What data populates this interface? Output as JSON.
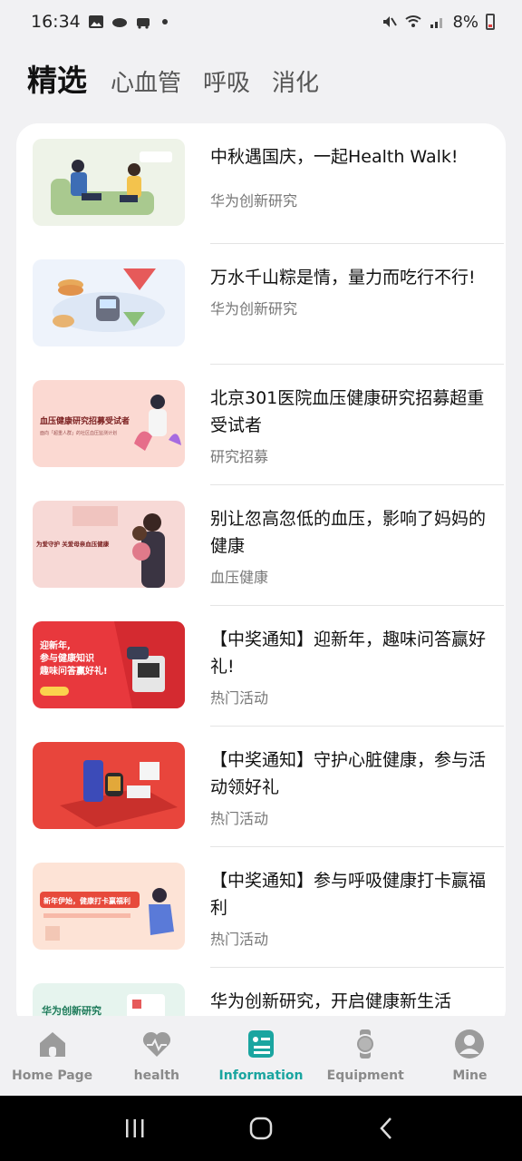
{
  "status": {
    "time": "16:34",
    "battery": "8%"
  },
  "tabs": [
    {
      "label": "精选",
      "active": true
    },
    {
      "label": "心血管"
    },
    {
      "label": "呼吸"
    },
    {
      "label": "消化"
    }
  ],
  "articles": [
    {
      "title": "中秋遇国庆，一起Health Walk!",
      "source": "华为创新研究"
    },
    {
      "title": "万水千山粽是情，量力而吃行不行!",
      "source": "华为创新研究"
    },
    {
      "title": "北京301医院血压健康研究招募超重受试者",
      "source": "研究招募"
    },
    {
      "title": "别让忽高忽低的血压，影响了妈妈的健康",
      "source": "血压健康"
    },
    {
      "title": "【中奖通知】迎新年，趣味问答赢好礼!",
      "source": "热门活动"
    },
    {
      "title": "【中奖通知】守护心脏健康，参与活动领好礼",
      "source": "热门活动"
    },
    {
      "title": "【中奖通知】参与呼吸健康打卡赢福利",
      "source": "热门活动"
    },
    {
      "title": "华为创新研究，开启健康新生活",
      "source": ""
    }
  ],
  "thumb_text": {
    "t3_heading": "血压健康研究招募受试者",
    "t3_sub": "面向「超重人群」的社区血压监测计划",
    "t4_text": "为爱守护 关爱母亲血压健康",
    "t5_line1": "迎新年,",
    "t5_line2": "参与健康知识",
    "t5_line3": "趣味问答赢好礼!",
    "t7_text": "新年伊始，健康打卡赢福利",
    "t8_text": "华为创新研究"
  },
  "nav": [
    {
      "label": "Home Page",
      "icon": "home-icon"
    },
    {
      "label": "health",
      "icon": "heart-pulse-icon"
    },
    {
      "label": "Information",
      "icon": "article-icon",
      "active": true
    },
    {
      "label": "Equipment",
      "icon": "watch-icon"
    },
    {
      "label": "Mine",
      "icon": "profile-icon"
    }
  ],
  "colors": {
    "accent": "#1aa5a0",
    "inactive": "#8a8a8a"
  }
}
